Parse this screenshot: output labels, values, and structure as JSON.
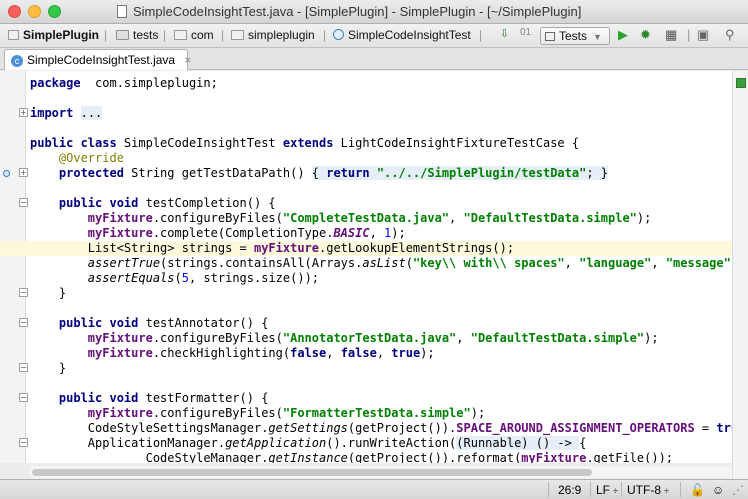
{
  "window": {
    "title": "SimpleCodeInsightTest.java - [SimplePlugin] - SimplePlugin - [~/SimplePlugin]"
  },
  "nav": {
    "crumbs": [
      "SimplePlugin",
      "tests",
      "com",
      "simpleplugin",
      "SimpleCodeInsightTest"
    ],
    "run_config": "Tests"
  },
  "tab": {
    "label": "SimpleCodeInsightTest.java",
    "close": "×"
  },
  "status": {
    "position": "26:9",
    "line_sep": "LF",
    "encoding": "UTF-8"
  },
  "code": [
    [
      [
        "kw",
        "package"
      ],
      [
        "",
        "  com.simpleplugin;"
      ]
    ],
    [],
    [
      [
        "kw",
        "import"
      ],
      [
        "",
        " "
      ],
      [
        "fbg",
        "..."
      ]
    ],
    [],
    [
      [
        "kw",
        "public class"
      ],
      [
        "",
        " SimpleCodeInsightTest "
      ],
      [
        "kw",
        "extends"
      ],
      [
        "",
        " LightCodeInsightFixtureTestCase {"
      ]
    ],
    [
      [
        "ann",
        "    @Override"
      ]
    ],
    [
      [
        "kw",
        "    protected"
      ],
      [
        "",
        " String getTestDataPath() "
      ],
      [
        "fbg",
        "{ "
      ],
      [
        "kw fbg",
        "return"
      ],
      [
        "fbg",
        " "
      ],
      [
        "str fbg",
        "\"../../SimplePlugin/testData\""
      ],
      [
        "fbg",
        "; }"
      ]
    ],
    [],
    [
      [
        "kw",
        "    public void"
      ],
      [
        "",
        " testCompletion() {"
      ]
    ],
    [
      [
        "",
        "        "
      ],
      [
        "fld",
        "myFixture"
      ],
      [
        "",
        ".configureByFiles("
      ],
      [
        "str",
        "\"CompleteTestData.java\""
      ],
      [
        "",
        ", "
      ],
      [
        "str",
        "\"DefaultTestData.simple\""
      ],
      [
        "",
        ");"
      ]
    ],
    [
      [
        "",
        "        "
      ],
      [
        "fld",
        "myFixture"
      ],
      [
        "",
        ".complete(CompletionType."
      ],
      [
        "sfld",
        "BASIC"
      ],
      [
        "",
        ", "
      ],
      [
        "num",
        "1"
      ],
      [
        "",
        ");"
      ]
    ],
    [
      [
        "",
        "        List<String> strings = "
      ],
      [
        "fld",
        "myFixture"
      ],
      [
        "",
        ".getLookupElementStrings();"
      ]
    ],
    [
      [
        "",
        "        "
      ],
      [
        "ita",
        "assertTrue"
      ],
      [
        "",
        "(strings.containsAll(Arrays."
      ],
      [
        "ita",
        "asList"
      ],
      [
        "",
        "("
      ],
      [
        "str",
        "\"key\\\\ with\\\\ spaces\""
      ],
      [
        "",
        ", "
      ],
      [
        "str",
        "\"language\""
      ],
      [
        "",
        ", "
      ],
      [
        "str",
        "\"message\""
      ],
      [
        "",
        ", "
      ],
      [
        "str",
        "\""
      ]
    ],
    [
      [
        "",
        "        "
      ],
      [
        "ita",
        "assertEquals"
      ],
      [
        "",
        "("
      ],
      [
        "num",
        "5"
      ],
      [
        "",
        ", strings.size());"
      ]
    ],
    [
      [
        "",
        "    }"
      ]
    ],
    [],
    [
      [
        "kw",
        "    public void"
      ],
      [
        "",
        " testAnnotator() {"
      ]
    ],
    [
      [
        "",
        "        "
      ],
      [
        "fld",
        "myFixture"
      ],
      [
        "",
        ".configureByFiles("
      ],
      [
        "str",
        "\"AnnotatorTestData.java\""
      ],
      [
        "",
        ", "
      ],
      [
        "str",
        "\"DefaultTestData.simple\""
      ],
      [
        "",
        ");"
      ]
    ],
    [
      [
        "",
        "        "
      ],
      [
        "fld",
        "myFixture"
      ],
      [
        "",
        ".checkHighlighting("
      ],
      [
        "kw",
        "false"
      ],
      [
        "",
        ", "
      ],
      [
        "kw",
        "false"
      ],
      [
        "",
        ", "
      ],
      [
        "kw",
        "true"
      ],
      [
        "",
        ");"
      ]
    ],
    [
      [
        "",
        "    }"
      ]
    ],
    [],
    [
      [
        "kw",
        "    public void"
      ],
      [
        "",
        " testFormatter() {"
      ]
    ],
    [
      [
        "",
        "        "
      ],
      [
        "fld",
        "myFixture"
      ],
      [
        "",
        ".configureByFiles("
      ],
      [
        "str",
        "\"FormatterTestData.simple\""
      ],
      [
        "",
        ");"
      ]
    ],
    [
      [
        "",
        "        CodeStyleSettingsManager."
      ],
      [
        "ita",
        "getSettings"
      ],
      [
        "",
        "(getProject())."
      ],
      [
        "fld",
        "SPACE_AROUND_ASSIGNMENT_OPERATORS"
      ],
      [
        "",
        " = "
      ],
      [
        "kw",
        "true"
      ],
      [
        "",
        ";"
      ]
    ],
    [
      [
        "",
        "        ApplicationManager."
      ],
      [
        "ita",
        "getApplication"
      ],
      [
        "",
        "().runWriteAction("
      ],
      [
        "fbg",
        "(Runnable) () -> "
      ],
      [
        "",
        "{"
      ]
    ],
    [
      [
        "",
        "                CodeStyleManager."
      ],
      [
        "ita",
        "getInstance"
      ],
      [
        "",
        "(getProject()).reformat("
      ],
      [
        "fld",
        "myFixture"
      ],
      [
        "",
        ".getFile());"
      ]
    ]
  ]
}
